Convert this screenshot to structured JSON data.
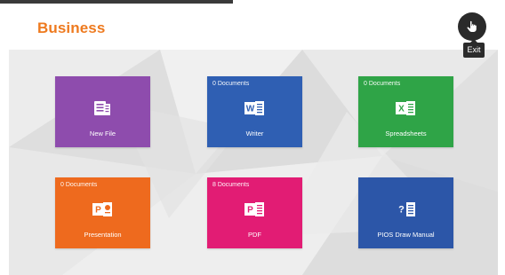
{
  "header": {
    "title": "Business",
    "exit_tooltip": "Exit",
    "exit_icon": "hand-pointer-icon"
  },
  "colors": {
    "accent": "#ee7a1f",
    "new_file": "#8e4cad",
    "writer": "#2f5fb3",
    "spreadsheets": "#2fa447",
    "presentation": "#ee6a1e",
    "pdf": "#e21c74",
    "manual": "#2c56a8"
  },
  "tiles": [
    {
      "label": "New File",
      "count": "",
      "icon": "new-file-icon",
      "letter": ""
    },
    {
      "label": "Writer",
      "count": "0 Documents",
      "icon": "writer-doc-icon",
      "letter": "W"
    },
    {
      "label": "Spreadsheets",
      "count": "0 Documents",
      "icon": "spreadsheet-icon",
      "letter": "X"
    },
    {
      "label": "Presentation",
      "count": "0 Documents",
      "icon": "presentation-icon",
      "letter": "P"
    },
    {
      "label": "PDF",
      "count": "8 Documents",
      "icon": "pdf-icon",
      "letter": "P"
    },
    {
      "label": "PIOS Draw Manual",
      "count": "",
      "icon": "help-manual-icon",
      "letter": "?"
    }
  ]
}
